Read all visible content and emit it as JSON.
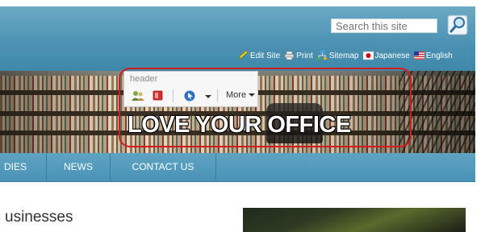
{
  "search": {
    "placeholder": "Search this site"
  },
  "utility_links": {
    "edit_site": "Edit Site",
    "print": "Print",
    "sitemap": "Sitemap",
    "japanese": "Japanese",
    "english": "English"
  },
  "toolbar": {
    "label": "header",
    "more": "More"
  },
  "banner": {
    "slogan": "LOVE YOUR OFFICE"
  },
  "nav": {
    "items": [
      "DIES",
      "NEWS",
      "CONTACT US"
    ]
  },
  "content": {
    "heading": "usinesses"
  },
  "colors": {
    "accent": "#4d93b3",
    "highlight": "#d31d1d"
  }
}
